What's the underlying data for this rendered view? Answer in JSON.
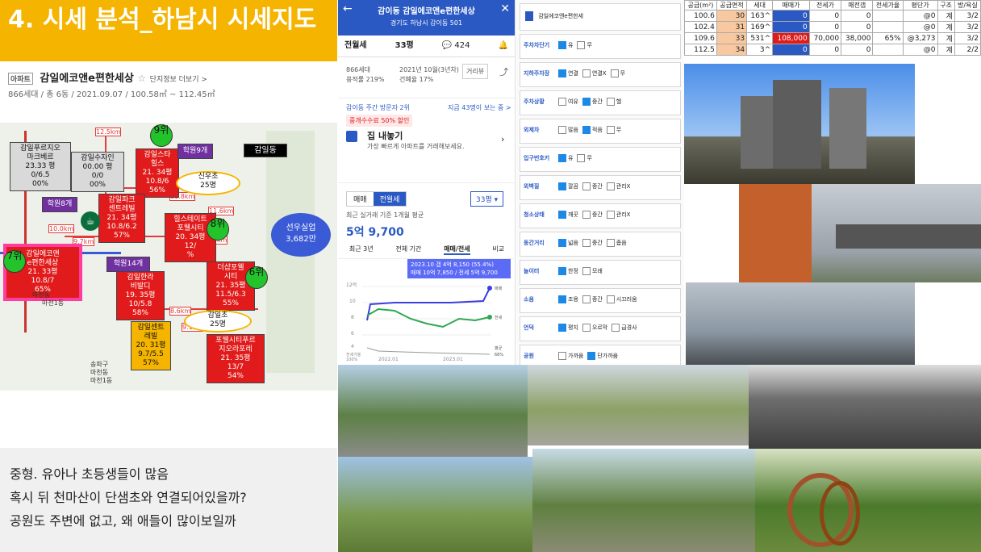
{
  "title": "4. 시세 분석_하남시 시세지도",
  "complex": {
    "chip": "아파트",
    "name": "감일에코앤e편한세상",
    "star": "☆",
    "link": "단지정보 더보기 >",
    "meta": "866세대 / 총 6동 / 2021.09.07 / 100.58㎡ ~ 112.45㎡"
  },
  "map": {
    "boxes": [
      {
        "name": "감일푸르지오마크베르",
        "lines": [
          "감일푸르지오",
          "마크베르",
          "23.33 평",
          "0/6.5",
          "00%"
        ],
        "style": "gray"
      },
      {
        "name": "감일수자인",
        "lines": [
          "감일수자인",
          "00.00 평",
          "0/0",
          "00%"
        ],
        "style": "gray"
      },
      {
        "name": "감일스타힐스",
        "lines": [
          "감일스타",
          "힐스",
          "21. 34평",
          "10.8/6",
          "56%"
        ],
        "style": "red"
      },
      {
        "name": "감일파크센트레빌",
        "lines": [
          "감일파크",
          "센트레빌",
          "21. 34평",
          "10.8/6.2",
          "57%"
        ],
        "style": "red"
      },
      {
        "name": "힐스테이트포웰시티",
        "lines": [
          "힐스테이트",
          "포웰시티",
          "20. 34평",
          "12/",
          "%"
        ],
        "style": "red"
      },
      {
        "name": "감일에코앤e편한세상",
        "lines": [
          "감일에코앤",
          "e편한세상",
          "21. 33평",
          "10.8/7",
          "65%"
        ],
        "style": "red"
      },
      {
        "name": "감일한라비발디",
        "lines": [
          "감일한라",
          "비발디",
          "19. 35평",
          "10/5.8",
          "58%"
        ],
        "style": "red"
      },
      {
        "name": "더샵포웰시티",
        "lines": [
          "더샵포웰",
          "시티",
          "21. 35평",
          "11.5/6.3",
          "55%"
        ],
        "style": "red"
      },
      {
        "name": "감일센트레빌",
        "lines": [
          "감일센트",
          "레빌",
          "20. 31평",
          "9.7/5.5",
          "57%"
        ],
        "style": "orange"
      },
      {
        "name": "포웰시티푸르지오라포레",
        "lines": [
          "포웰시티푸르",
          "지오라포레",
          "21. 35평",
          "13/7",
          "54%"
        ],
        "style": "red"
      }
    ],
    "schools": [
      "학원9개",
      "학원8개",
      "학원14개"
    ],
    "dong": "감일동",
    "ovals": [
      [
        "신우초",
        "25명"
      ],
      [
        "감일초",
        "25명"
      ]
    ],
    "invest": [
      "선우실업",
      "3,682만"
    ],
    "ranks": [
      "9위",
      "8위",
      "7위",
      "6위"
    ],
    "distances": [
      "12.5km",
      "11.8km",
      "10.0km",
      "9.7km",
      "11.4km",
      "11.6km",
      "8.6km",
      "9.1km"
    ],
    "places": [
      "마천동",
      "마천1동",
      "송파구",
      "마천동",
      "마천1동"
    ]
  },
  "notes": [
    "중형. 유아나 초등생들이 많음",
    "혹시 뒤 천마산이 단샘초와 연결되어있을까?",
    "공원도 주변에 없고,  왜 애들이 많이보일까"
  ],
  "app": {
    "header": "감이동 감일에코앤e편한세상",
    "address": "경기도 하남시 감이동 501",
    "tabs": [
      "전월세",
      "33평",
      "424"
    ],
    "units": "866세대",
    "ratio": "용적률 219%",
    "built": "2021년 10월(3년차)",
    "ratio2": "건폐율 17%",
    "street_btn": "거리뷰",
    "visitors": "감이동 주간 방문자 2위",
    "viewers": "지금 43명이 보는 중 >",
    "fee_badge": "중개수수료 50% 할인",
    "sell_title": "집 내놓기",
    "sell_sub": "가장 빠르게 아파트를 거래해보세요.",
    "seg": [
      "매매",
      "전월세"
    ],
    "size_sel": "33평 ▾",
    "avg_label": "최근 실거래 기준 1개월 평균",
    "avg_value": "5억 9,700",
    "periods": [
      "최근 3년",
      "전체 기간",
      "매매/전세",
      "비교"
    ],
    "tooltip1": "2023.10  갭 4억 8,150 (55.4%)",
    "tooltip2": "매매 10억 7,850 / 전세 5억 9,700",
    "y_ticks": [
      "12억",
      "10",
      "8",
      "6",
      "4"
    ],
    "y2_ticks": [
      "전세가율",
      "100%"
    ],
    "x_ticks": [
      "2022.01",
      "2023.01"
    ],
    "legend": [
      "매매",
      "전세",
      "평균",
      "68%"
    ]
  },
  "filter": {
    "search": "감일에코앤e편한세",
    "rows": [
      {
        "label": "주차차단기",
        "opts": [
          [
            "유",
            true
          ],
          [
            "무",
            false
          ]
        ]
      },
      {
        "label": "지하주차장",
        "opts": [
          [
            "연결",
            true
          ],
          [
            "연결X",
            false
          ],
          [
            "무",
            false
          ]
        ]
      },
      {
        "label": "주차상황",
        "opts": [
          [
            "여유",
            false
          ],
          [
            "중간",
            true
          ],
          [
            "헬",
            false
          ]
        ]
      },
      {
        "label": "외제차",
        "opts": [
          [
            "많음",
            false
          ],
          [
            "적음",
            true
          ],
          [
            "무",
            false
          ]
        ]
      },
      {
        "label": "입구번호키",
        "opts": [
          [
            "유",
            true
          ],
          [
            "무",
            false
          ]
        ]
      },
      {
        "label": "외벽질",
        "opts": [
          [
            "깔끔",
            true
          ],
          [
            "중간",
            false
          ],
          [
            "관리X",
            false
          ]
        ]
      },
      {
        "label": "청소상태",
        "opts": [
          [
            "깨끗",
            true
          ],
          [
            "중간",
            false
          ],
          [
            "관리X",
            false
          ]
        ]
      },
      {
        "label": "동간거리",
        "opts": [
          [
            "넓음",
            true
          ],
          [
            "중간",
            false
          ],
          [
            "좁음",
            false
          ]
        ]
      },
      {
        "label": "놀이터",
        "opts": [
          [
            "한정",
            true
          ],
          [
            "모래",
            false
          ]
        ]
      },
      {
        "label": "소음",
        "opts": [
          [
            "조용",
            true
          ],
          [
            "중간",
            false
          ],
          [
            "시끄러움",
            false
          ]
        ]
      },
      {
        "label": "언덕",
        "opts": [
          [
            "평지",
            true
          ],
          [
            "오르막",
            false
          ],
          [
            "급경사",
            false
          ]
        ]
      },
      {
        "label": "공원",
        "opts": [
          [
            "가까움",
            false
          ],
          [
            "단가까움",
            true
          ]
        ]
      },
      {
        "label": "초등학교",
        "opts": [
          [
            "초품아/가까움",
            false
          ],
          [
            "단가까움",
            true
          ]
        ]
      }
    ]
  },
  "table": {
    "headers": [
      "공급(m²)",
      "공급면적",
      "세대",
      "매매가",
      "전세가",
      "매전갭",
      "전세가율",
      "평단가",
      "구조",
      "방/욕실"
    ],
    "rows": [
      [
        "100.6",
        "30",
        "163^",
        "0",
        "0",
        "0",
        "",
        "@0",
        "계",
        "3/2"
      ],
      [
        "102.4",
        "31",
        "169^",
        "0",
        "0",
        "0",
        "",
        "@0",
        "계",
        "3/2"
      ],
      [
        "109.6",
        "33",
        "531^",
        "108,000",
        "70,000",
        "38,000",
        "65%",
        "@3,273",
        "계",
        "3/2"
      ],
      [
        "112.5",
        "34",
        "3^",
        "0",
        "0",
        "0",
        "",
        "@0",
        "계",
        "2/2"
      ]
    ]
  },
  "colors": {
    "banner": "#f5b400",
    "red": "#e11b1b",
    "blue": "#2b59c3",
    "green": "#22c32b"
  }
}
